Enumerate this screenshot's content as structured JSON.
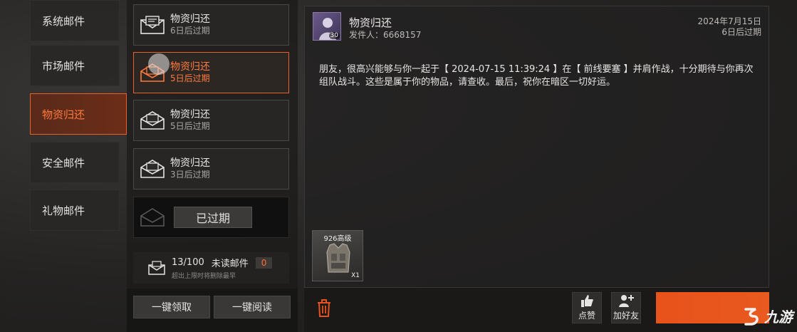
{
  "categories": [
    {
      "label": "系统邮件"
    },
    {
      "label": "市场邮件"
    },
    {
      "label": "物资归还"
    },
    {
      "label": "安全邮件"
    },
    {
      "label": "礼物邮件"
    }
  ],
  "mail_list": [
    {
      "title": "物资归还",
      "sub": "6日后过期"
    },
    {
      "title": "物资归还",
      "sub": "5日后过期"
    },
    {
      "title": "物资归还",
      "sub": "5日后过期"
    },
    {
      "title": "物资归还",
      "sub": "3日后过期"
    },
    {
      "badge": "已过期"
    }
  ],
  "counter": {
    "count": "13/100",
    "label": "未读邮件",
    "unread": "0",
    "note": "超出上限时将删除最早"
  },
  "buttons": {
    "claim_all": "一键领取",
    "read_all": "一键阅读",
    "like": "点赞",
    "add_friend": "加好友"
  },
  "detail": {
    "title": "物资归还",
    "sender": "发件人：6668157",
    "date": "2024年7月15日",
    "expiry": "6日后过期",
    "avatar_level": "30",
    "body": "朋友，很高兴能够与你一起于【 2024-07-15 11:39:24 】在【 前线要塞 】并肩作战，十分期待与你再次组队战斗。这些是属于你的物品，请查收。最后，祝你在暗区一切好运。",
    "attachment": {
      "label": "926高级",
      "qty": "X1"
    }
  },
  "watermark": "九游",
  "colors": {
    "accent": "#e8602c",
    "accent_text": "#ff7a3d",
    "orange_button": "#e8521c"
  }
}
